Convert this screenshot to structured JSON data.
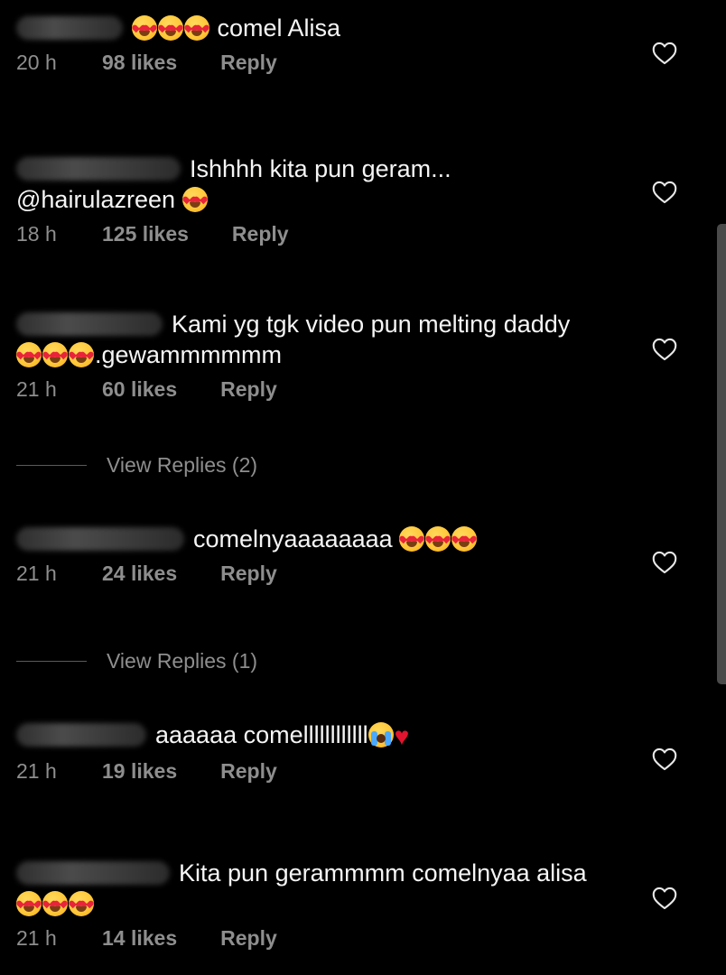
{
  "comments": [
    {
      "text": "comel Alisa",
      "time": "20 h",
      "likes": "98 likes",
      "reply": "Reply"
    },
    {
      "text": "Ishhhh kita pun geram...",
      "mention": "@hairulazreen",
      "time": "18 h",
      "likes": "125 likes",
      "reply": "Reply"
    },
    {
      "text": "Kami yg tgk video pun melting daddy",
      "text2": ".gewammmmmm",
      "time": "21 h",
      "likes": "60 likes",
      "reply": "Reply",
      "view_replies": "View Replies (2)"
    },
    {
      "text": "comelnyaaaaaaaa",
      "time": "21 h",
      "likes": "24 likes",
      "reply": "Reply",
      "view_replies": "View Replies (1)"
    },
    {
      "text": "aaaaaa comellllllllllll",
      "time": "21 h",
      "likes": "19 likes",
      "reply": "Reply"
    },
    {
      "text": "Kita pun gerammmm comelnyaa alisa",
      "time": "21 h",
      "likes": "14 likes",
      "reply": "Reply"
    }
  ],
  "icons": {
    "like": "heart-outline-icon",
    "emoji_love": "heart-eyes-emoji",
    "emoji_cry": "loudly-crying-emoji",
    "emoji_heart": "red-heart-emoji"
  },
  "colors": {
    "background": "#000000",
    "text": "#f5f5f5",
    "meta": "#8e8e8e"
  }
}
